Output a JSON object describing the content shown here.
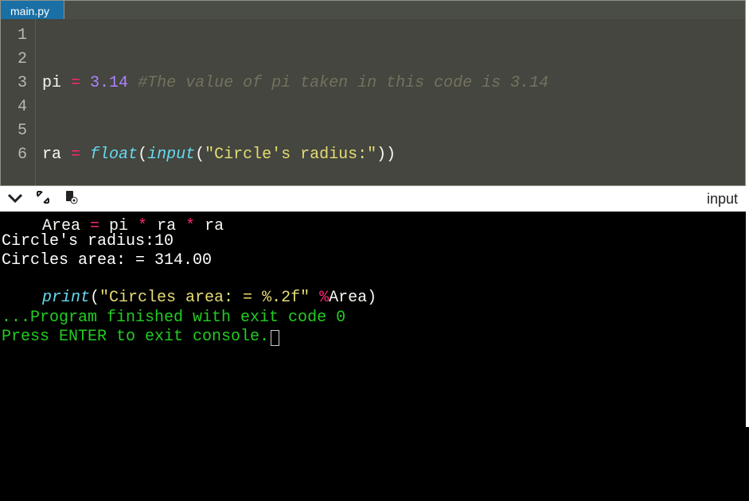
{
  "tab": {
    "name": "main.py"
  },
  "gutter": {
    "l1": "1",
    "l2": "2",
    "l3": "3",
    "l4": "4",
    "l5": "5",
    "l6": "6"
  },
  "code": {
    "l1": {
      "a": "pi ",
      "op1": "=",
      "b": " ",
      "num": "3.14",
      "sp": " ",
      "comment": "#The value of pi taken in this code is 3.14"
    },
    "l2": {
      "a": "ra ",
      "op1": "=",
      "b": " ",
      "flt": "float",
      "p1": "(",
      "inp": "input",
      "p2": "(",
      "str": "\"Circle's radius:\"",
      "p3": "))"
    },
    "l3": {
      "a": "Area ",
      "op1": "=",
      "b": " pi ",
      "op2": "*",
      "c": " ra ",
      "op3": "*",
      "d": " ra"
    },
    "l4": {
      "fn": "print",
      "p1": "(",
      "str": "\"Circles area: = %.2f\"",
      "sp": " ",
      "pct": "%",
      "arg": "Area",
      "p2": ")"
    }
  },
  "midbar": {
    "label": "input"
  },
  "icons": {
    "chev": "✔",
    "expand": "⤢",
    "toggle": "⬍"
  },
  "console": {
    "l1": "Circle's radius:10",
    "l2": "Circles area: = 314.00",
    "blank": "",
    "l3": "...Program finished with exit code 0",
    "l4": "Press ENTER to exit console."
  }
}
